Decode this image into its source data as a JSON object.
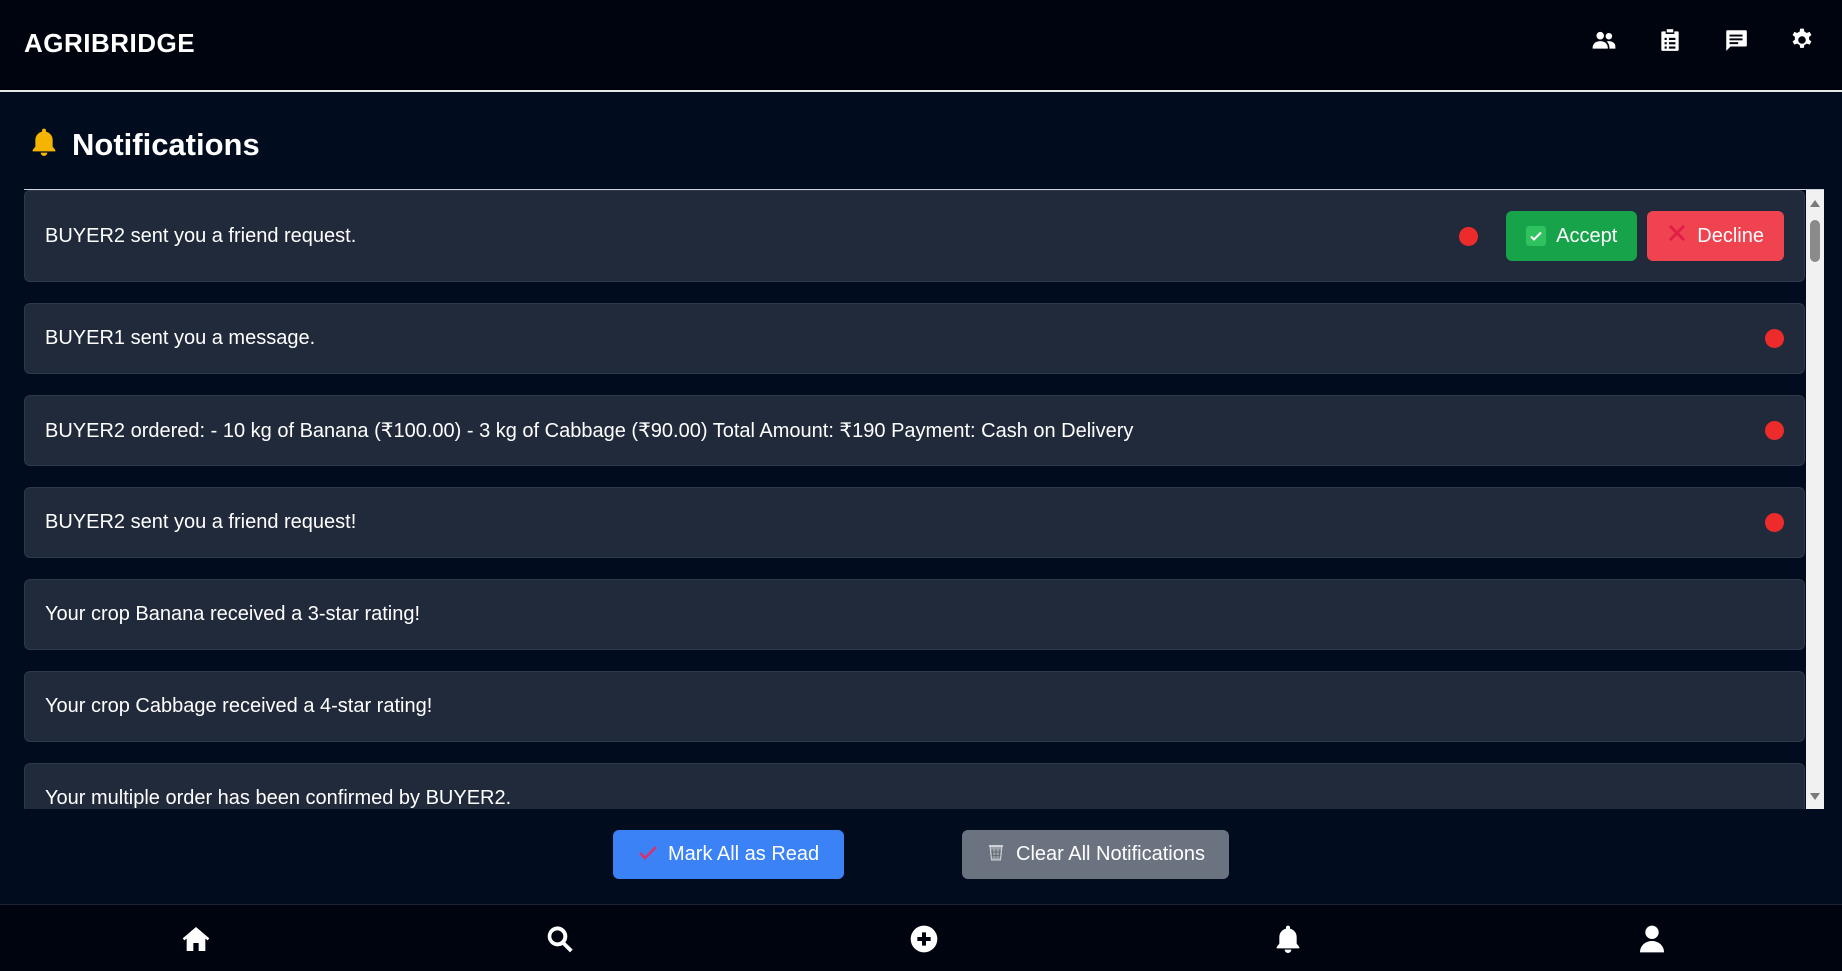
{
  "app": {
    "brand": "AGRIBRIDGE"
  },
  "topbar": {
    "icons": [
      "users-icon",
      "clipboard-icon",
      "message-icon",
      "gear-icon"
    ]
  },
  "page": {
    "title": "Notifications",
    "title_icon": "bell-icon",
    "title_icon_color": "#f5b400"
  },
  "notifications": [
    {
      "text": "BUYER2 sent you a friend request.",
      "unread": true,
      "accept_label": "Accept",
      "decline_label": "Decline"
    },
    {
      "text": "BUYER1 sent you a message.",
      "unread": true
    },
    {
      "text": "BUYER2 ordered: - 10 kg of Banana (₹100.00) - 3 kg of Cabbage (₹90.00) Total Amount: ₹190 Payment: Cash on Delivery",
      "unread": true
    },
    {
      "text": "BUYER2 sent you a friend request!",
      "unread": true
    },
    {
      "text": "Your crop Banana received a 3-star rating!",
      "unread": false
    },
    {
      "text": "Your crop Cabbage received a 4-star rating!",
      "unread": false
    },
    {
      "text": "Your multiple order has been confirmed by BUYER2.",
      "unread": false
    }
  ],
  "actions": {
    "mark_read_label": "Mark All as Read",
    "clear_label": "Clear All Notifications"
  },
  "bottomnav": {
    "icons": [
      "home-icon",
      "search-icon",
      "add-circle-icon",
      "bell-icon",
      "user-icon"
    ]
  },
  "colors": {
    "background": "#010c1f",
    "card": "#212a3b",
    "unread_dot": "#ee2b2b",
    "accept": "#16a34a",
    "decline": "#ef4350",
    "mark_read": "#3b82f6",
    "clear": "#6b7280"
  }
}
